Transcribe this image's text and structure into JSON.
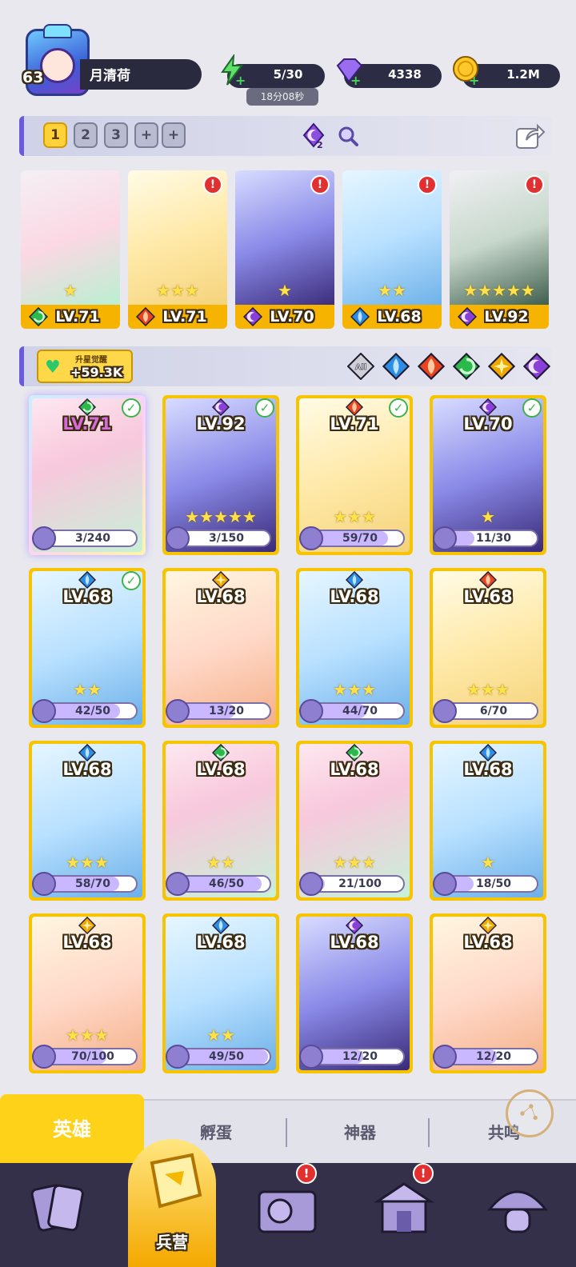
{
  "player": {
    "level": "63",
    "name": "月清荷"
  },
  "resources": {
    "energy": "5/30",
    "energy_timer": "18分08秒",
    "gems": "4338",
    "coins": "1.2M"
  },
  "team_bar": {
    "slots": [
      "1",
      "2",
      "3",
      "+",
      "+"
    ],
    "active_slot": "1",
    "moon_badge": "2"
  },
  "team": [
    {
      "level": "LV.71",
      "element": "wind",
      "stars": "★",
      "alert": "!",
      "hasAlert": false
    },
    {
      "level": "LV.71",
      "element": "fire",
      "stars": "★★★",
      "alert": "!",
      "hasAlert": true
    },
    {
      "level": "LV.70",
      "element": "dark",
      "stars": "★",
      "alert": "!",
      "hasAlert": true
    },
    {
      "level": "LV.68",
      "element": "water",
      "stars": "★★",
      "alert": "!",
      "hasAlert": true
    },
    {
      "level": "LV.92",
      "element": "dark",
      "stars": "★★★★★",
      "alert": "!",
      "hasAlert": true
    }
  ],
  "awaken": {
    "label": "升星觉醒",
    "value": "+59.3K"
  },
  "filters": [
    {
      "name": "all",
      "label": "All"
    },
    {
      "name": "water"
    },
    {
      "name": "fire"
    },
    {
      "name": "wind"
    },
    {
      "name": "light"
    },
    {
      "name": "dark"
    }
  ],
  "heroes": [
    {
      "level": "LV.71",
      "element": "wind",
      "progress": "3/240",
      "ratio": 0.0125,
      "stars": "",
      "checked": true
    },
    {
      "level": "LV.92",
      "element": "dark",
      "progress": "3/150",
      "ratio": 0.02,
      "stars": "★★★★★",
      "checked": true
    },
    {
      "level": "LV.71",
      "element": "fire",
      "progress": "59/70",
      "ratio": 0.843,
      "stars": "★★★",
      "checked": true
    },
    {
      "level": "LV.70",
      "element": "dark",
      "progress": "11/30",
      "ratio": 0.367,
      "stars": "★",
      "checked": true
    },
    {
      "level": "LV.68",
      "element": "water",
      "progress": "42/50",
      "ratio": 0.84,
      "stars": "★★",
      "checked": true
    },
    {
      "level": "LV.68",
      "element": "light",
      "progress": "13/20",
      "ratio": 0.65,
      "stars": "",
      "checked": false
    },
    {
      "level": "LV.68",
      "element": "water",
      "progress": "44/70",
      "ratio": 0.629,
      "stars": "★★★",
      "checked": false
    },
    {
      "level": "LV.68",
      "element": "fire",
      "progress": "6/70",
      "ratio": 0.086,
      "stars": "★★★",
      "checked": false
    },
    {
      "level": "LV.68",
      "element": "water",
      "progress": "58/70",
      "ratio": 0.829,
      "stars": "★★★",
      "checked": false
    },
    {
      "level": "LV.68",
      "element": "wind",
      "progress": "46/50",
      "ratio": 0.92,
      "stars": "★★",
      "checked": false
    },
    {
      "level": "LV.68",
      "element": "wind",
      "progress": "21/100",
      "ratio": 0.21,
      "stars": "★★★",
      "checked": false
    },
    {
      "level": "LV.68",
      "element": "water",
      "progress": "18/50",
      "ratio": 0.36,
      "stars": "★",
      "checked": false
    },
    {
      "level": "LV.68",
      "element": "light",
      "progress": "70/100",
      "ratio": 0.7,
      "stars": "★★★",
      "checked": false
    },
    {
      "level": "LV.68",
      "element": "water",
      "progress": "49/50",
      "ratio": 0.98,
      "stars": "★★",
      "checked": false
    },
    {
      "level": "LV.68",
      "element": "dark",
      "progress": "12/20",
      "ratio": 0.6,
      "stars": "",
      "checked": false
    },
    {
      "level": "LV.68",
      "element": "light",
      "progress": "12/20",
      "ratio": 0.6,
      "stars": "",
      "checked": false
    }
  ],
  "tabs": [
    "英雄",
    "孵蛋",
    "神器",
    "共鸣"
  ],
  "nav": {
    "active_label": "兵营",
    "alert": "!"
  },
  "colors": {
    "gold": "#f6c400",
    "purple": "#6a5bd8",
    "water": "#2b8de6",
    "fire": "#e84420",
    "wind": "#2cb84a",
    "light": "#f0a800",
    "dark": "#8a3fd8"
  }
}
